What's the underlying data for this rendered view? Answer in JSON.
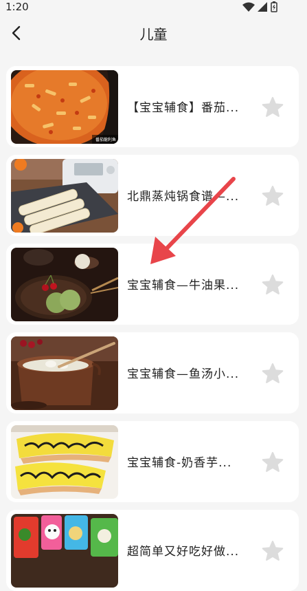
{
  "status_bar": {
    "time": "1:20",
    "icons": [
      "wifi-icon",
      "signal-icon",
      "battery-icon"
    ]
  },
  "header": {
    "back_icon": "chevron-left-icon",
    "title": "儿童"
  },
  "recipes": [
    {
      "title": "【宝宝辅食】番茄...",
      "thumb_caption": "番茄龍利鱼"
    },
    {
      "title": "北鼎蒸炖锅食谱—..."
    },
    {
      "title": "宝宝辅食—牛油果..."
    },
    {
      "title": "宝宝辅食—鱼汤小..."
    },
    {
      "title": "宝宝辅食-奶香芋..."
    },
    {
      "title": "超简单又好吃好做..."
    }
  ],
  "colors": {
    "background": "#f5f5f5",
    "card": "#ffffff",
    "star": "#dcdcdc",
    "annotation_arrow": "#e8454a"
  }
}
